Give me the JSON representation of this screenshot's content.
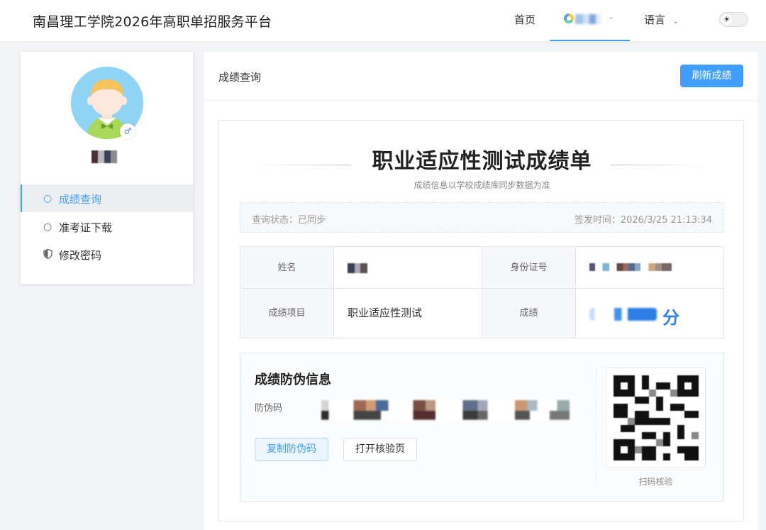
{
  "header": {
    "site_title": "南昌理工学院2026年高职单招服务平台",
    "nav_home": "首页",
    "nav_language": "语言",
    "user_chevron": "⌄",
    "lang_chevron": "⌄",
    "theme_icon": "☀",
    "accent_color": "#409eff"
  },
  "sidebar": {
    "items": [
      {
        "icon": "circle-icon",
        "label": "成绩查询",
        "active": true
      },
      {
        "icon": "circle-icon",
        "label": "准考证下载",
        "active": false
      },
      {
        "icon": "shield-icon",
        "label": "修改密码",
        "active": false
      }
    ]
  },
  "main": {
    "title": "成绩查询",
    "refresh_button": "刷新成绩",
    "card": {
      "title": "职业适应性测试成绩单",
      "subtitle": "成绩信息以学校成绩库同步数据为准",
      "status_text": "查询状态：已同步",
      "issue_time": "签发时间：2026/3/25 21:13:34",
      "table": {
        "name_label": "姓名",
        "id_label": "身份证号",
        "project_label": "成绩项目",
        "project_value": "职业适应性测试",
        "score_label": "成绩",
        "score_unit": "分"
      },
      "anti_fake": {
        "title": "成绩防伪信息",
        "code_label": "防伪码",
        "copy_button": "复制防伪码",
        "open_button": "打开核验页",
        "qr_label": "扫码核验"
      }
    }
  }
}
